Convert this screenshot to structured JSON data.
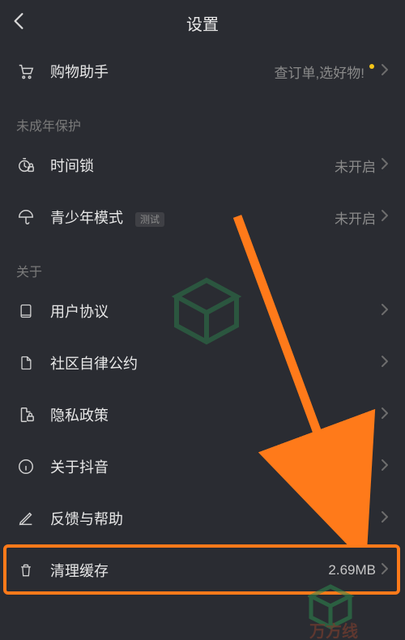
{
  "header": {
    "title": "设置"
  },
  "shopping": {
    "label": "购物助手",
    "value": "查订单,选好物!"
  },
  "sections": {
    "minor_protection": {
      "title": "未成年保护"
    },
    "about": {
      "title": "关于"
    }
  },
  "time_lock": {
    "label": "时间锁",
    "value": "未开启"
  },
  "teen_mode": {
    "label": "青少年模式",
    "badge": "测试",
    "value": "未开启"
  },
  "user_agreement": {
    "label": "用户协议"
  },
  "community_rules": {
    "label": "社区自律公约"
  },
  "privacy_policy": {
    "label": "隐私政策"
  },
  "about_douyin": {
    "label": "关于抖音"
  },
  "feedback_help": {
    "label": "反馈与帮助"
  },
  "clear_cache": {
    "label": "清理缓存",
    "value": "2.69MB"
  },
  "colors": {
    "accent_arrow": "#ff7a1a"
  }
}
